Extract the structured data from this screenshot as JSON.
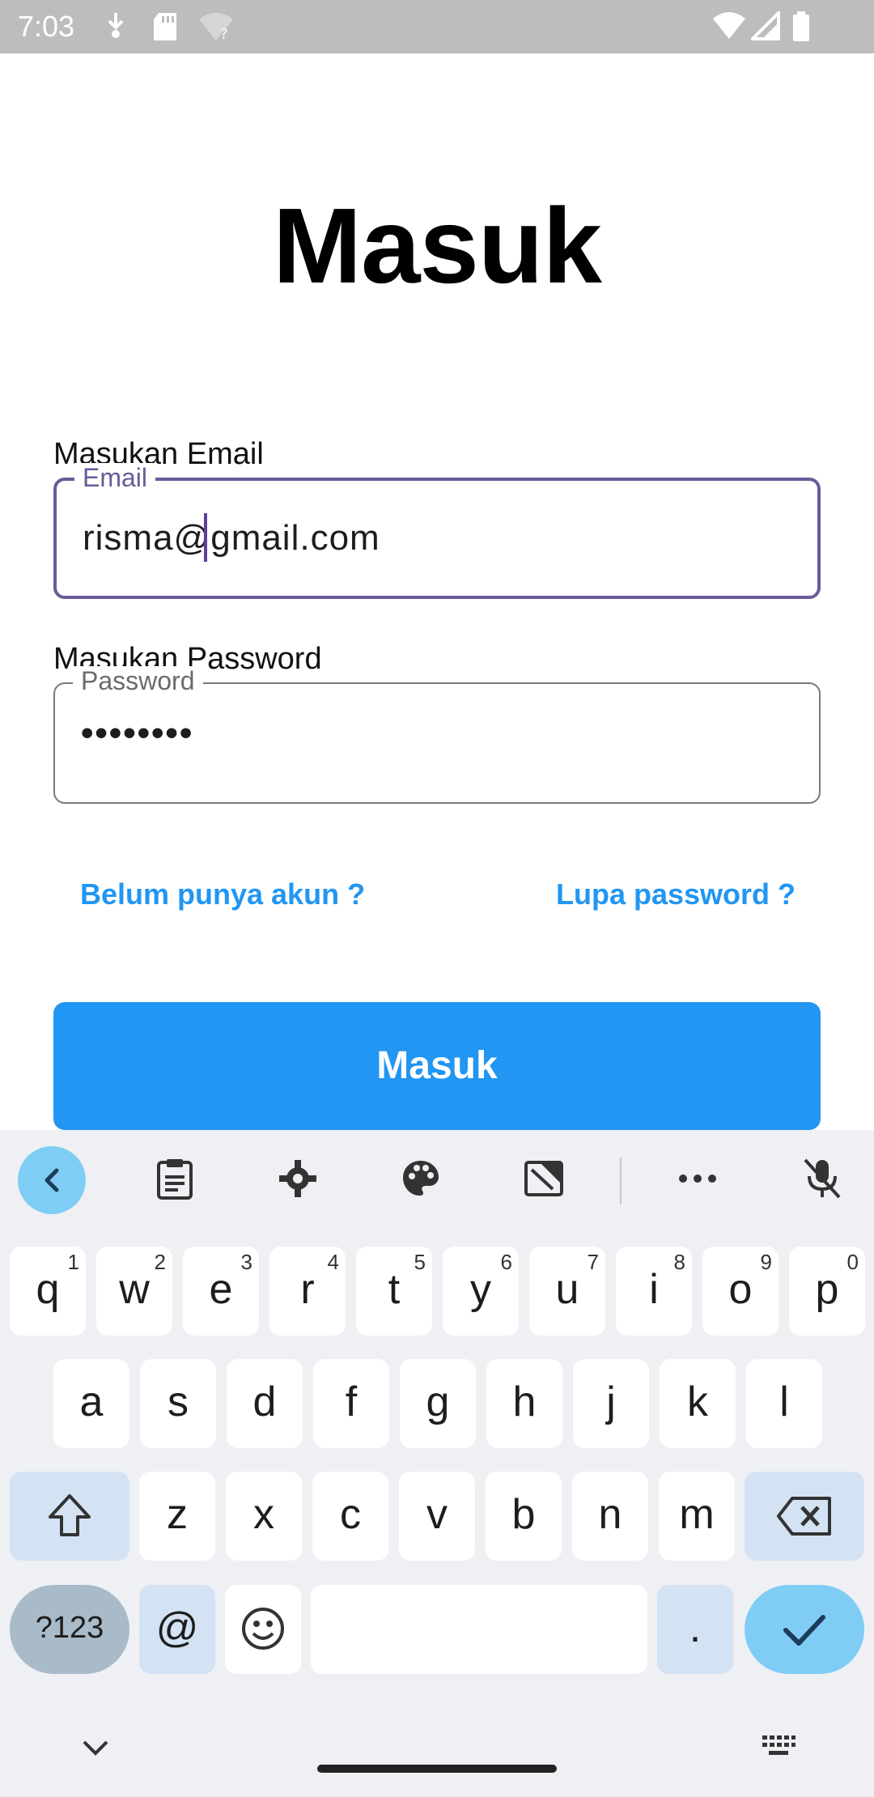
{
  "status_bar": {
    "time": "7:03",
    "left_icons": [
      "download-icon",
      "sd-card-icon",
      "wifi-question-icon"
    ],
    "right_icons": [
      "wifi-icon",
      "signal-icon",
      "battery-icon"
    ]
  },
  "page": {
    "title": "Masuk"
  },
  "email": {
    "label": "Masukan Email",
    "floating_label": "Email",
    "value": "risma@gmail.com"
  },
  "password": {
    "label": "Masukan Password",
    "floating_label": "Password",
    "value": "••••••••"
  },
  "links": {
    "register": "Belum punya akun ?",
    "forgot": "Lupa password ?"
  },
  "primary_button": {
    "label": "Masuk"
  },
  "colors": {
    "primary": "#2196f3",
    "focus_border": "#6a5a99",
    "keyboard_bg": "#eff0f4"
  },
  "keyboard": {
    "toolbar": [
      "back-icon",
      "clipboard-icon",
      "settings-icon",
      "palette-icon",
      "resize-icon",
      "more-icon",
      "mic-off-icon"
    ],
    "row1": [
      {
        "k": "q",
        "s": "1"
      },
      {
        "k": "w",
        "s": "2"
      },
      {
        "k": "e",
        "s": "3"
      },
      {
        "k": "r",
        "s": "4"
      },
      {
        "k": "t",
        "s": "5"
      },
      {
        "k": "y",
        "s": "6"
      },
      {
        "k": "u",
        "s": "7"
      },
      {
        "k": "i",
        "s": "8"
      },
      {
        "k": "o",
        "s": "9"
      },
      {
        "k": "p",
        "s": "0"
      }
    ],
    "row2": [
      "a",
      "s",
      "d",
      "f",
      "g",
      "h",
      "j",
      "k",
      "l"
    ],
    "row3": [
      "z",
      "x",
      "c",
      "v",
      "b",
      "n",
      "m"
    ],
    "sym_label": "?123",
    "at_label": "@",
    "period_label": "."
  }
}
